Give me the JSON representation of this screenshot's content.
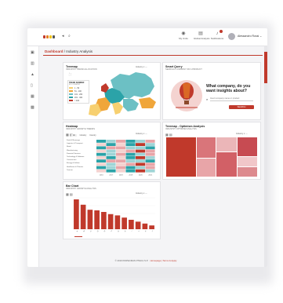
{
  "app": {
    "logo_colors": [
      "#c0392b",
      "#e67e22",
      "#f1c40f",
      "#555555"
    ]
  },
  "header": {
    "nav": [
      {
        "icon": "user-icon",
        "label": "My Units"
      },
      {
        "icon": "building-icon",
        "label": "Global Analysis"
      },
      {
        "icon": "bell-icon",
        "label": "Notifications"
      }
    ],
    "username": "Alessandro Rossi ⌄"
  },
  "sidebar": {
    "icons": [
      "home-icon",
      "chart-icon",
      "upload-icon",
      "document-icon",
      "calendar-icon",
      "grid-icon"
    ]
  },
  "breadcrumb": {
    "prefix": "Dashboard",
    "page": "Industry Analysis"
  },
  "panels": {
    "map": {
      "title": "Treemap",
      "subtitle": "INDUSTRY TREND ALLOCATION",
      "tools": "Industry ▾  ⋯",
      "legend_title": "TREND NUMBER",
      "legend_sub": "BY COUNTRY",
      "legend": [
        {
          "label": "1 - 50",
          "color": "#f7d070"
        },
        {
          "label": "51 - 100",
          "color": "#f0a63a"
        },
        {
          "label": "101 - 200",
          "color": "#6cc0c4"
        },
        {
          "label": "201 - 400",
          "color": "#2ba3a8"
        },
        {
          "label": "> 400",
          "color": "#c0392b"
        }
      ]
    },
    "query": {
      "title": "Smart Query",
      "subtitle": "SEARCH A COMPANY OR A PRODUCT",
      "heading": "What company, do you want insights about?",
      "placeholder": "Insert company name or product",
      "button": "SEARCH"
    },
    "heatmap": {
      "title": "Heatmap",
      "subtitle": "INDUSTRY GROWTH TRENDS",
      "tools": "Industry ▾  ⋯",
      "tabs": [
        "All",
        "Industry",
        "Country"
      ],
      "rows": [
        "Food & Beverage",
        "Logistics & Transport",
        "Retail",
        "Manufacturing",
        "Financial Services",
        "Technology & Software",
        "Construction",
        "Energy & Utilities",
        "Healthcare & Pharma",
        "Tourism"
      ],
      "columns": [
        "2016",
        "2017",
        "2018",
        "2019",
        "2020",
        "2021"
      ]
    },
    "treemap": {
      "title": "Treemap - Optimism Analysis",
      "subtitle": "INDUSTRY OPTIMISM ANALYSIS",
      "tools": "Industry ▾  ⋯"
    },
    "bar": {
      "title": "Bar Chart",
      "subtitle": "INDUSTRY GROWTH ANALYSIS",
      "tools": "Industry ▾  ⋯"
    }
  },
  "chart_data": {
    "type": "bar",
    "categories": [
      "A",
      "B",
      "C",
      "D",
      "E",
      "F",
      "G",
      "H",
      "I",
      "J",
      "K",
      "L"
    ],
    "values": [
      95,
      78,
      62,
      60,
      55,
      48,
      44,
      37,
      30,
      24,
      18,
      12
    ],
    "ylim": [
      0,
      100
    ],
    "color": "#c0392b"
  },
  "footer": {
    "text": "© 2019 INSPECMAN PTECH S.P.",
    "links": "Homepage | Terms & Apply"
  }
}
